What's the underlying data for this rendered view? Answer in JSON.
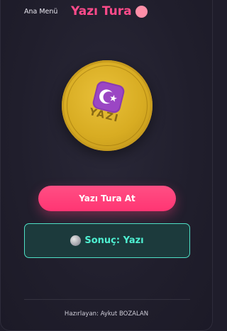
{
  "header": {
    "back_label": "Ana Menü",
    "title": "Yazı Tura"
  },
  "coin": {
    "face_label": "YAZI",
    "emblem_icon": "star-and-crescent-icon",
    "color": "#d8ac22"
  },
  "actions": {
    "flip_label": "Yazı Tura At"
  },
  "result": {
    "text": "Sonuç: Yazı",
    "icon": "coin-icon"
  },
  "footer": {
    "credit": "Hazırlayan: Aykut BOZALAN"
  },
  "colors": {
    "accent_pink": "#ff4b8b",
    "result_teal": "#4ff0d2",
    "background": "#1f1d2b"
  }
}
